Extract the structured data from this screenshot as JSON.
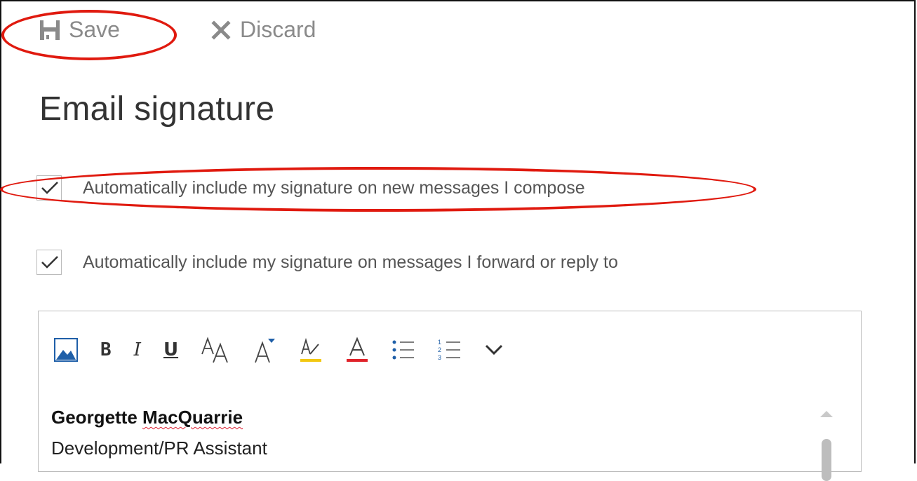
{
  "toolbar": {
    "save_label": "Save",
    "discard_label": "Discard",
    "save_icon": "floppy-disk-icon",
    "discard_icon": "close-x-icon"
  },
  "page": {
    "title": "Email signature"
  },
  "options": {
    "new_messages_label": "Automatically include my signature on new messages I compose",
    "new_messages_checked": true,
    "replies_label": "Automatically include my signature on messages I forward or reply to",
    "replies_checked": true
  },
  "formatting_toolbar": {
    "items": [
      {
        "name": "insert-picture-icon"
      },
      {
        "name": "bold-button",
        "glyph": "B"
      },
      {
        "name": "italic-button",
        "glyph": "I"
      },
      {
        "name": "underline-button",
        "glyph": "U"
      },
      {
        "name": "font-size-icon"
      },
      {
        "name": "grow-font-icon"
      },
      {
        "name": "highlight-icon"
      },
      {
        "name": "font-color-icon"
      },
      {
        "name": "bullets-icon"
      },
      {
        "name": "numbering-icon"
      },
      {
        "name": "more-options-icon"
      }
    ],
    "highlight_color": "#f2c811",
    "font_color": "#e0232a"
  },
  "signature": {
    "name": "Georgette MacQuarrie",
    "name_first": "Georgette",
    "name_last": "MacQuarrie",
    "title": "Development/PR Assistant"
  },
  "colors": {
    "annotation": "#e01a0f",
    "picture_icon": "#1f5fa8"
  }
}
